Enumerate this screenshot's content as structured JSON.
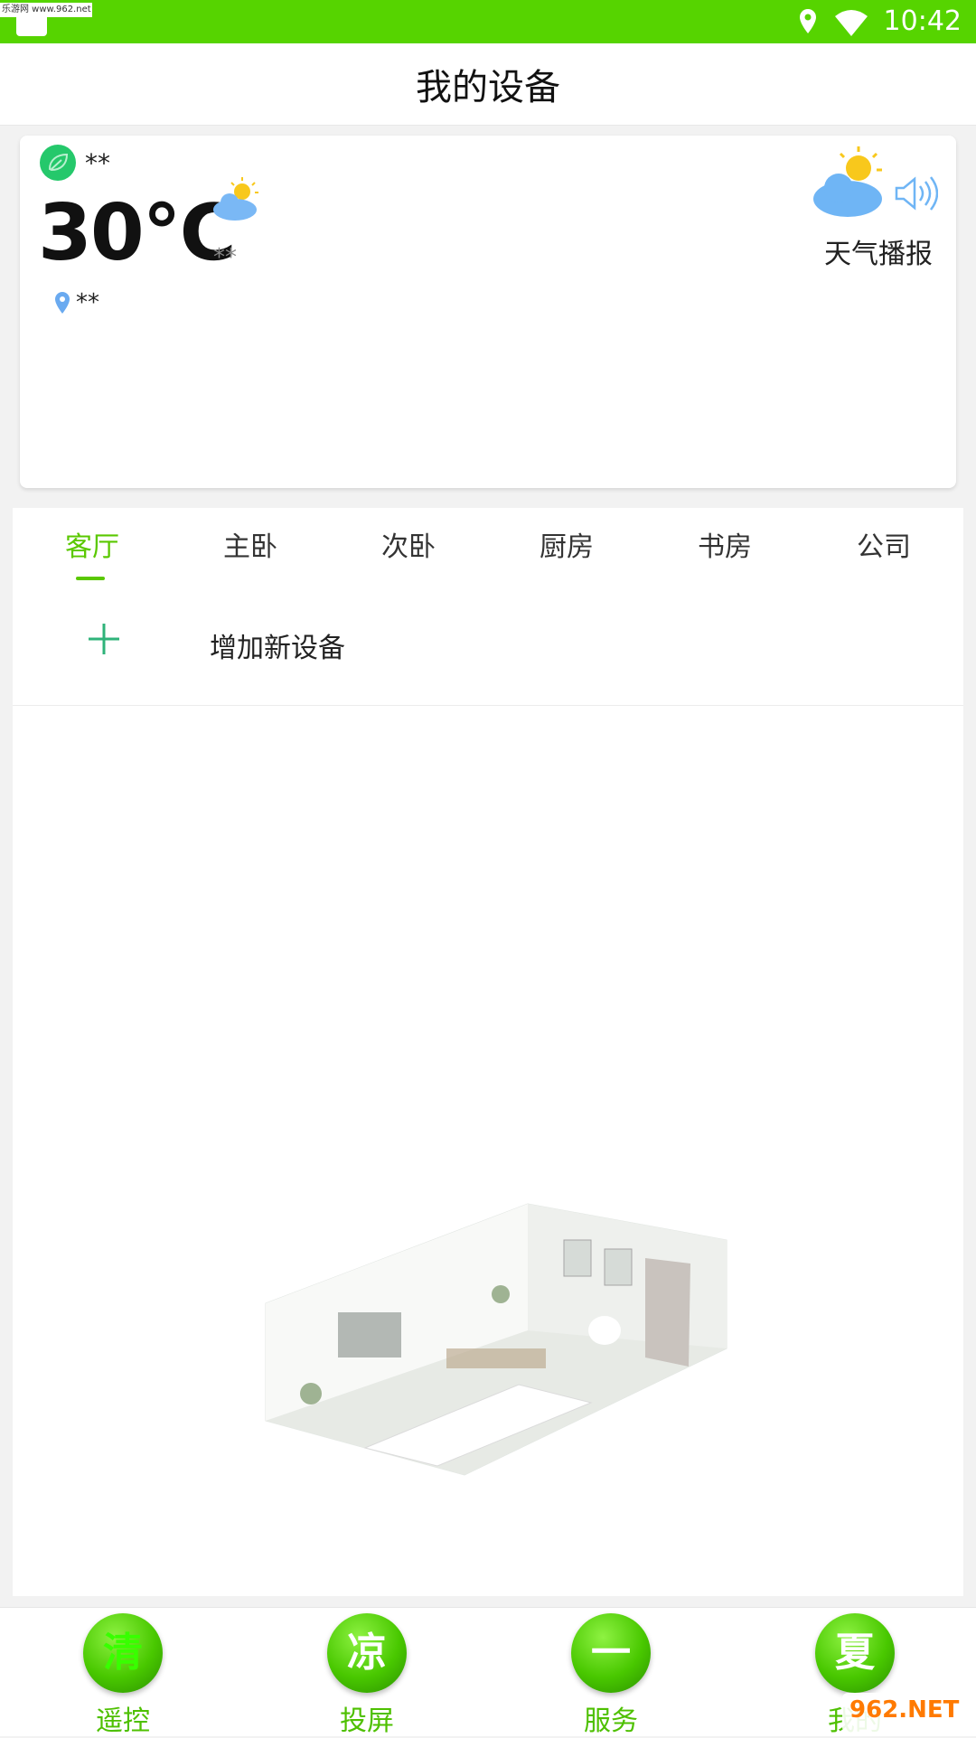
{
  "status_bar": {
    "time": "10:42",
    "watermark": "乐游网 www.962.net"
  },
  "header": {
    "title": "我的设备"
  },
  "weather": {
    "air_quality": "**",
    "temperature": "30℃",
    "condition": "**",
    "location": "**",
    "broadcast_label": "天气播报"
  },
  "rooms": {
    "tabs": [
      "客厅",
      "主卧",
      "次卧",
      "厨房",
      "书房",
      "公司"
    ],
    "active_tab": "客厅",
    "add_device_label": "增加新设备"
  },
  "bottom_nav": {
    "items": [
      {
        "orb": "清",
        "label": "遥控"
      },
      {
        "orb": "凉",
        "label": "投屏"
      },
      {
        "orb": "一",
        "label": "服务"
      },
      {
        "orb": "夏",
        "label": "我的"
      }
    ]
  },
  "corner_logo": "962.NET",
  "colors": {
    "accent": "#5ac800",
    "status_bar": "#56d400",
    "leaf_badge": "#25c86b"
  }
}
